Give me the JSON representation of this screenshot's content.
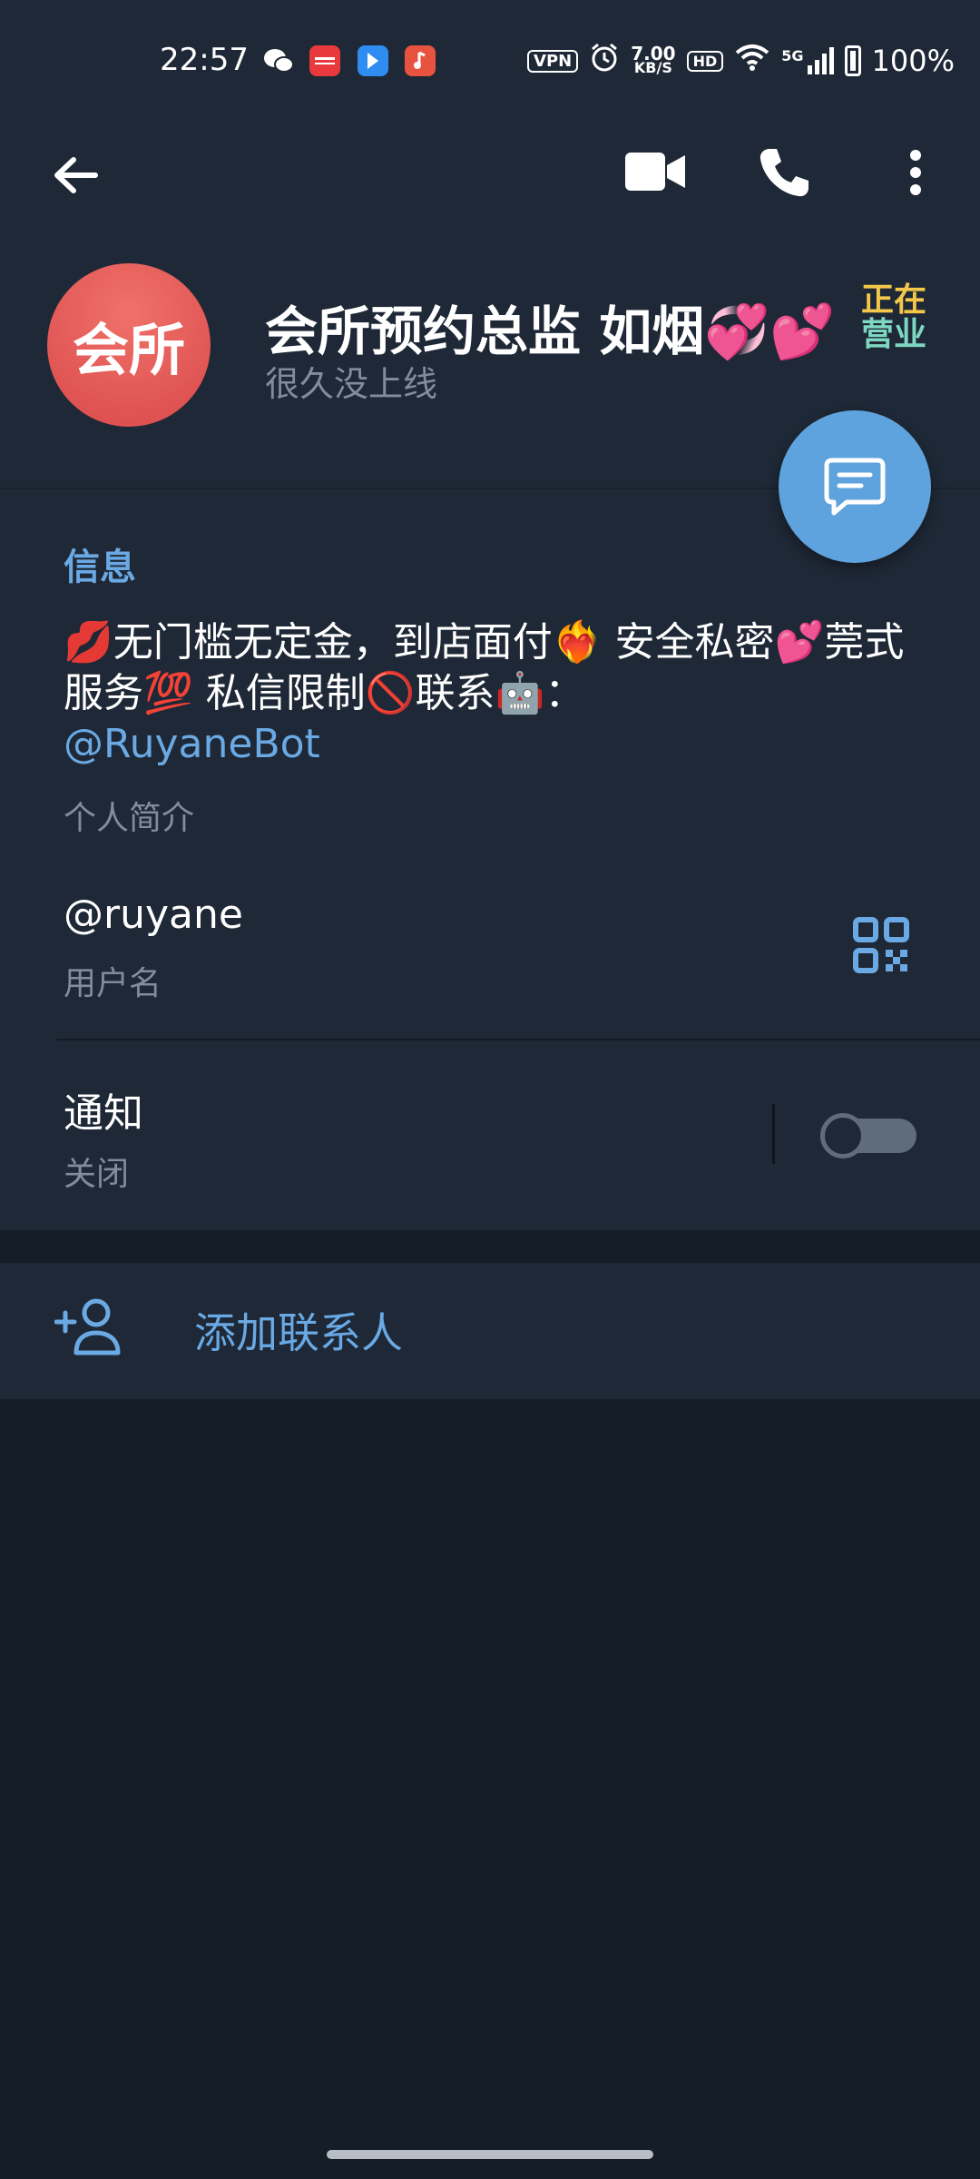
{
  "status_bar": {
    "time": "22:57",
    "app_icons": [
      "wechat-icon",
      "xiaohongshu-icon",
      "blue-app-icon",
      "music-app-icon"
    ],
    "vpn_label": "VPN",
    "speed_value": "7.00",
    "speed_unit": "KB/S",
    "hd_label": "HD",
    "network_label": "5G",
    "battery_label": "100%"
  },
  "toolbar": {
    "back_icon": "arrow-left-icon",
    "video_icon": "video-camera-icon",
    "call_icon": "phone-icon",
    "more_icon": "more-vertical-icon"
  },
  "profile": {
    "avatar_text": "会所",
    "name": "会所预约总监 如烟💞💕",
    "badge_line1": "正在",
    "badge_line2": "营业",
    "last_seen": "很久没上线"
  },
  "info": {
    "section_title": "信息",
    "bio_text": "💋无门槛无定金，到店面付❤️‍🔥 安全私密💕莞式服务💯 私信限制🚫联系🤖：",
    "bio_link": "@RuyaneBot",
    "bio_caption": "个人简介",
    "username": "@ruyane",
    "username_caption": "用户名",
    "notifications_label": "通知",
    "notifications_state": "关闭",
    "notifications_enabled": false
  },
  "actions": {
    "add_contact_label": "添加联系人"
  },
  "colors": {
    "header_bg": "#1e2836",
    "page_bg": "#151d27",
    "accent": "#6aa9e3",
    "fab": "#5ea3dd",
    "avatar": "#e05a57",
    "secondary_text": "#7f8d9e"
  }
}
